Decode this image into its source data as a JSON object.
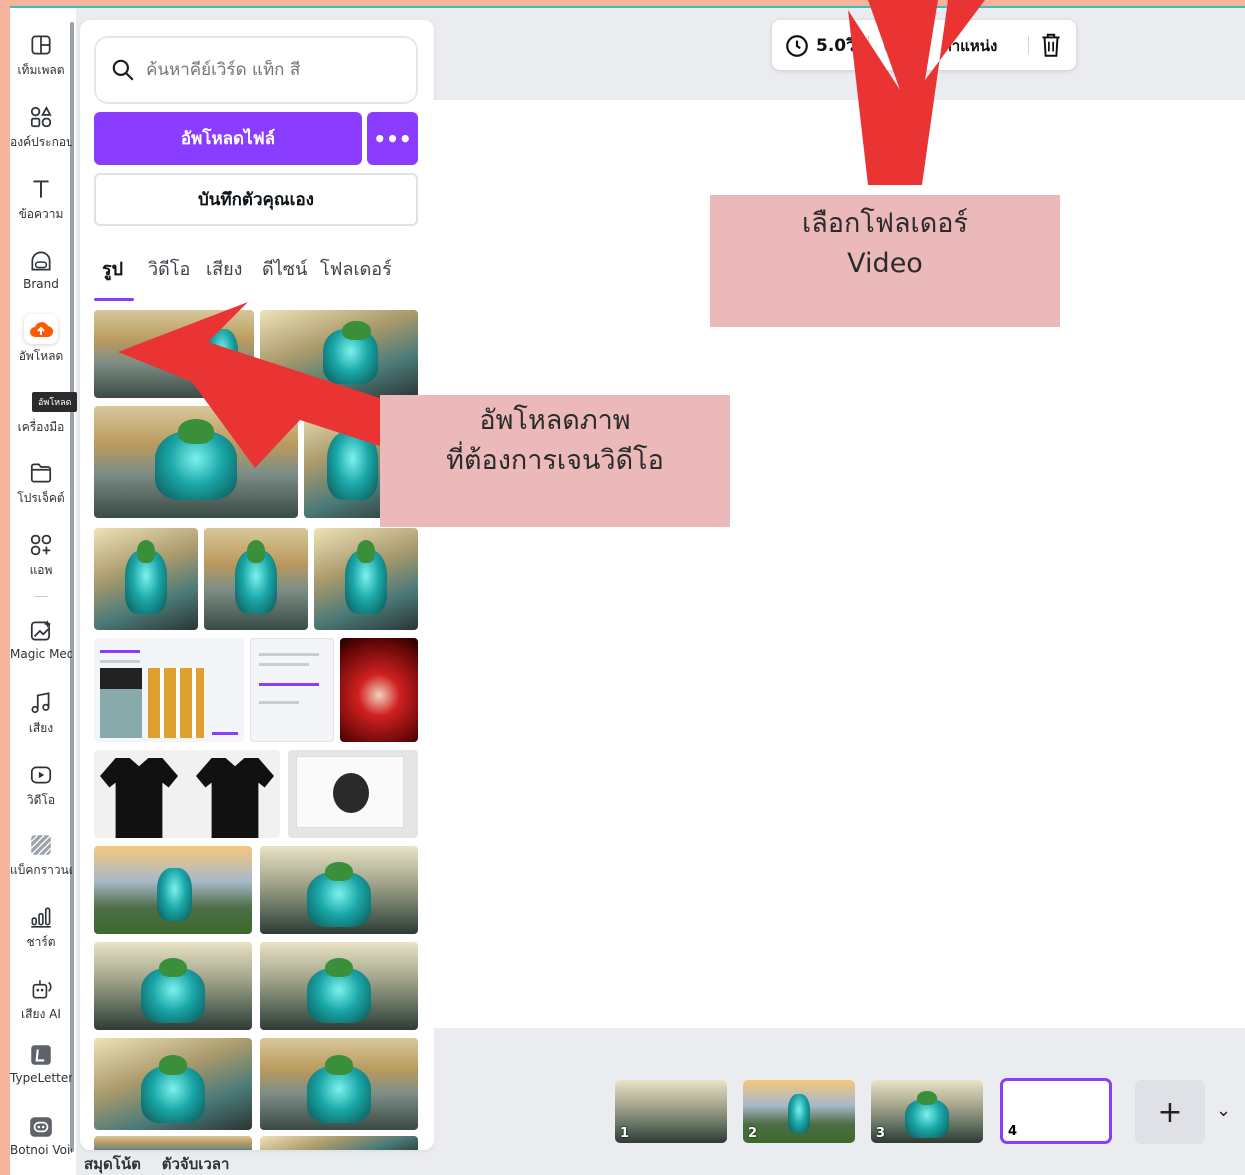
{
  "sidebar": {
    "items": [
      {
        "label": "เท็มเพลต",
        "icon": "template-icon"
      },
      {
        "label": "องค์ประกอบ",
        "icon": "elements-icon"
      },
      {
        "label": "ข้อความ",
        "icon": "text-icon"
      },
      {
        "label": "Brand",
        "icon": "brand-icon"
      },
      {
        "label": "อัพโหลด",
        "icon": "upload-cloud-icon"
      },
      {
        "label": "เครื่องมือ",
        "icon": "tools-icon"
      },
      {
        "label": "โปรเจ็คต์",
        "icon": "folder-icon"
      },
      {
        "label": "แอพ",
        "icon": "apps-icon"
      },
      {
        "label": "Magic Media",
        "icon": "magic-media-icon"
      },
      {
        "label": "เสียง",
        "icon": "music-icon"
      },
      {
        "label": "วิดีโอ",
        "icon": "video-icon"
      },
      {
        "label": "แบ็คกราวนด์",
        "icon": "background-icon"
      },
      {
        "label": "ชาร์ต",
        "icon": "chart-icon"
      },
      {
        "label": "เสียง AI",
        "icon": "ai-voice-icon"
      },
      {
        "label": "TypeLetter",
        "icon": "typeletter-icon"
      },
      {
        "label": "Botnoi Voice",
        "icon": "bot-icon"
      }
    ],
    "tooltip": "อัพโหลด"
  },
  "panel": {
    "search_placeholder": "ค้นหาคีย์เวิร์ด แท็ก สี",
    "upload_button": "อัพโหลดไฟล์",
    "more_button": "•••",
    "record_button": "บันทึกตัวคุณเอง",
    "tabs": [
      "รูป",
      "วิดีโอ",
      "เสียง",
      "ดีไซน์",
      "โฟลเดอร์"
    ]
  },
  "toolbar": {
    "duration": "5.0วิ",
    "position": "ตำแหน่ง"
  },
  "pages": [
    "1",
    "2",
    "3",
    "4"
  ],
  "add_page": "+",
  "footer": {
    "notes": "สมุดโน้ต",
    "timer": "ตัวจับเวลา"
  },
  "annotations": {
    "folder_line1": "เลือกโฟลเดอร์",
    "folder_line2": "Video",
    "upload_line1": "อัพโหลดภาพ",
    "upload_line2": "ที่ต้องการเจนวิดีโอ"
  },
  "colors": {
    "accent": "#8b3dff",
    "frame": "#f8b39c",
    "callout": "#ecb9ba",
    "arrow": "#ea3433"
  }
}
